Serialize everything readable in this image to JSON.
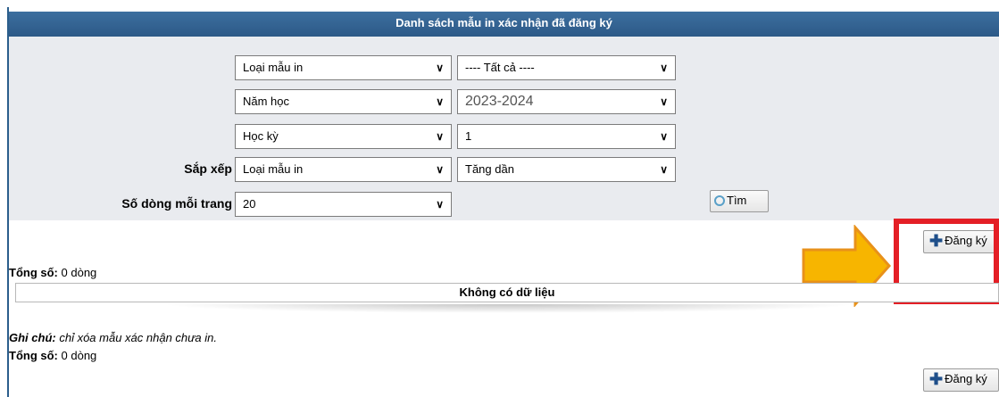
{
  "header": {
    "title": "Danh sách mẫu in xác nhận đã đăng ký",
    "collapse_icon": "chevron-down-icon"
  },
  "filters": {
    "loai_mau_in": "Loại mẫu in",
    "tat_ca": "---- Tất cả ----",
    "nam_hoc_label": "Năm học",
    "nam_hoc_value": "2023-2024",
    "hoc_ky_label": "Học kỳ",
    "hoc_ky_value": "1",
    "sap_xep_label": "Sắp xếp",
    "sap_xep_field": "Loại mẫu in",
    "sap_xep_order": "Tăng dần",
    "so_dong_label": "Số dòng mỗi trang",
    "so_dong_value": "20",
    "search_button": "Tìm",
    "search_icon": "search-icon"
  },
  "actions": {
    "register_button": "Đăng ký",
    "plus_icon": "plus-icon"
  },
  "results": {
    "total_label": "Tổng số:",
    "total_value": "0 dòng",
    "empty_text": "Không có dữ liệu"
  },
  "note": {
    "label": "Ghi chú:",
    "text": "chỉ xóa mẫu xác nhận chưa in."
  },
  "colors": {
    "header": "#2c5987",
    "panel": "#e9ebef",
    "highlight_box": "#e41f26",
    "arrow": "#f7b500"
  }
}
